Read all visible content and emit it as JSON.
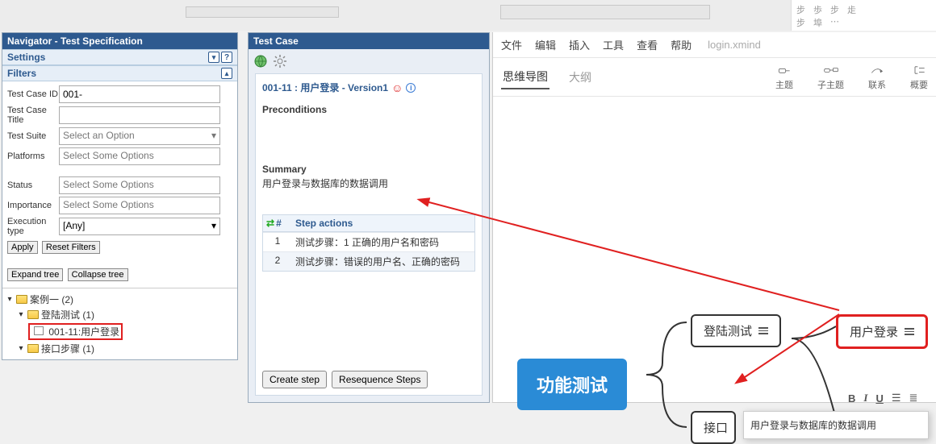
{
  "navigator": {
    "title": "Navigator - Test Specification",
    "settings_label": "Settings",
    "filters_label": "Filters",
    "labels": {
      "tc_id": "Test Case ID",
      "tc_title": "Test Case Title",
      "suite": "Test Suite",
      "platforms": "Platforms",
      "status": "Status",
      "importance": "Importance",
      "exec": "Execution type"
    },
    "values": {
      "tc_id": "001-",
      "tc_title": "",
      "suite": "Select an Option",
      "platforms": "Select Some Options",
      "status": "Select Some Options",
      "importance": "Select Some Options",
      "exec": "[Any]"
    },
    "buttons": {
      "apply": "Apply",
      "reset": "Reset Filters",
      "expand": "Expand tree",
      "collapse": "Collapse tree"
    },
    "tree": {
      "root": "案例一 (2)",
      "sub1": "登陆测试 (1)",
      "leaf1": "001-11:用户登录",
      "sub2": "接口步骤 (1)"
    }
  },
  "testcase": {
    "panel_title": "Test Case",
    "title": "001-11 : 用户登录 - Version1",
    "preconditions_label": "Preconditions",
    "summary_label": "Summary",
    "summary_text": "用户登录与数据库的数据调用",
    "steps_header": "Step actions",
    "steps_hash": "#",
    "steps": [
      {
        "num": "1",
        "text": "测试步骤：1 正确的用户名和密码"
      },
      {
        "num": "2",
        "text": "测试步骤：错误的用户名、正确的密码"
      }
    ],
    "btn_create": "Create step",
    "btn_reseq": "Resequence Steps"
  },
  "xmind": {
    "menu": [
      "文件",
      "编辑",
      "插入",
      "工具",
      "查看",
      "帮助"
    ],
    "filename": "login.xmind",
    "tabs": {
      "mindmap": "思维导图",
      "outline": "大纲"
    },
    "actions": {
      "topic": "主题",
      "subtopic": "子主题",
      "relate": "联系",
      "outline": "概要"
    },
    "nodes": {
      "main": "功能测试",
      "login_test": "登陆测试",
      "user_login": "用户登录",
      "interface": "接口"
    },
    "annotation": "用户登录与数据库的数据调用",
    "fmt": {
      "bold": "B",
      "italic": "I",
      "under": "U"
    }
  }
}
